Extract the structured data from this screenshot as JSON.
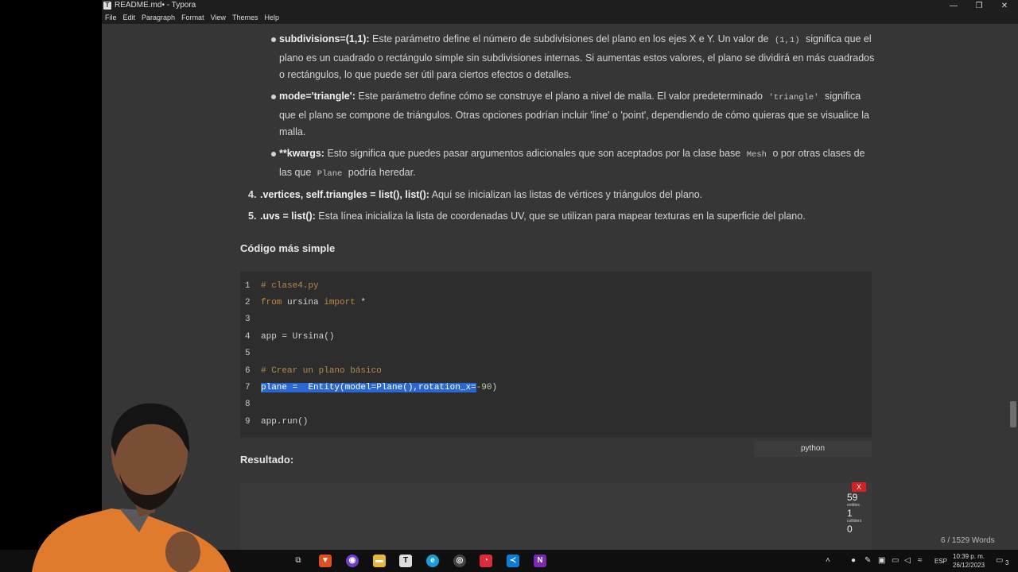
{
  "window": {
    "title": "README.md• - Typora",
    "app_icon": "T",
    "minimize": "—",
    "restore": "❐",
    "close": "✕"
  },
  "menu": [
    "File",
    "Edit",
    "Paragraph",
    "Format",
    "View",
    "Themes",
    "Help"
  ],
  "bullets": [
    {
      "strong": "subdivisions=(1,1):",
      "t1": " Este parámetro define el número de subdivisiones del plano en los ejes X e Y. Un valor de",
      "code1": "(1,1)",
      "t2": "significa que el plano es un cuadrado o rectángulo simple sin subdivisiones internas. Si aumentas estos valores, el plano se dividirá en más cuadrados o rectángulos, lo que puede ser útil para ciertos efectos o detalles."
    },
    {
      "strong": "mode='triangle':",
      "t1": " Este parámetro define cómo se construye el plano a nivel de malla. El valor predeterminado",
      "code1": "'triangle'",
      "t2": "significa que el plano se compone de triángulos. Otras opciones podrían incluir 'line' o 'point', dependiendo de cómo quieras que se visualice la malla."
    },
    {
      "strong": "**kwargs:",
      "t1": " Esto significa que puedes pasar argumentos adicionales que son aceptados por la clase base",
      "code1": "Mesh",
      "t2": "o por otras clases de las que",
      "code2": "Plane",
      "t3": "podría heredar."
    }
  ],
  "numbered": [
    {
      "num": "4.",
      "strong": ".vertices, self.triangles = list(), list():",
      "text": " Aquí se inicializan las listas de vértices y triángulos del plano."
    },
    {
      "num": "5.",
      "strong": ".uvs = list():",
      "text": " Esta línea inicializa la lista de coordenadas UV, que se utilizan para mapear texturas en la superficie del plano."
    }
  ],
  "heading_simple": "Código más simple",
  "code": {
    "line_numbers": [
      "1",
      "2",
      "3",
      "4",
      "5",
      "6",
      "7",
      "8",
      "9"
    ],
    "l1": "# clase4.py",
    "l2_kw1": "from",
    "l2_mid": " ursina ",
    "l2_kw2": "import",
    "l2_end": " *",
    "l4": "app = Ursina()",
    "l6": "# Crear un plano básico",
    "l7_sel": "plane =  Entity(model=Plane(),rotation_x=",
    "l7_num": "-90",
    "l7_end": ")",
    "l9": "app.run()",
    "language": "python"
  },
  "heading_result": "Resultado:",
  "stats": {
    "close": "X",
    "fps": "59",
    "entities_label": "entities",
    "entities": "1",
    "colliders_label": "colliders",
    "colliders": "0"
  },
  "wordcount": "6 / 1529 Words",
  "taskbar": {
    "lang": "ESP",
    "time": "10:39 p. m.",
    "date": "26/12/2023",
    "notif": "3"
  },
  "colors": {
    "selection": "#2b67d1",
    "background": "#363636",
    "code_bg": "#2d2d2d"
  }
}
